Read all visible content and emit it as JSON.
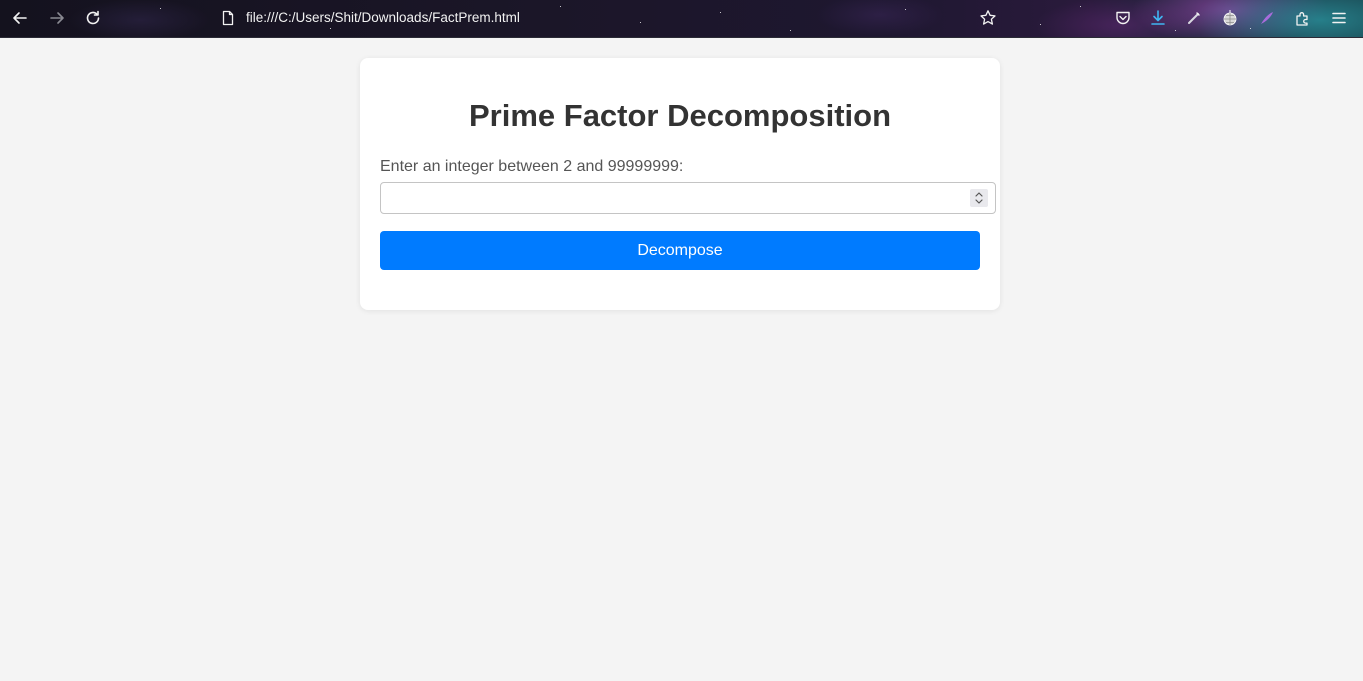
{
  "browser": {
    "url": "file:///C:/Users/Shit/Downloads/FactPrem.html",
    "icons": {
      "back": "back-arrow-icon",
      "forward": "forward-arrow-icon",
      "reload": "reload-icon",
      "page": "page-icon",
      "bookmark": "bookmark-star-icon",
      "pocket": "pocket-icon",
      "downloads": "download-icon",
      "extension_pen": "pen-extension-icon",
      "extension_globe": "globe-extension-icon",
      "extension_feather": "feather-extension-icon",
      "extensions": "puzzle-extensions-icon",
      "menu": "hamburger-menu-icon"
    },
    "accent_download": "#3fb6f2"
  },
  "page": {
    "title": "Prime Factor Decomposition",
    "input_label": "Enter an integer between 2 and 99999999:",
    "input_value": "",
    "button_label": "Decompose",
    "button_color": "#007bff",
    "background_color": "#f4f4f4"
  }
}
